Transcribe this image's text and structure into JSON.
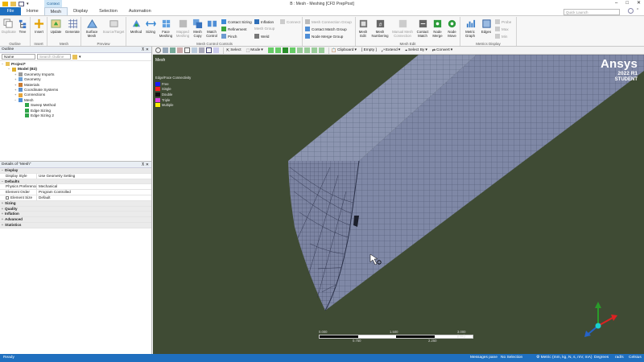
{
  "app": {
    "window_title": "B : Mesh - Meshing [CFD PrepPost]",
    "context_tab": "Context",
    "window_controls": [
      "–",
      "□",
      "✕"
    ]
  },
  "tabs": [
    {
      "label": "File",
      "active": false,
      "style": "file"
    },
    {
      "label": "Home",
      "active": false
    },
    {
      "label": "Mesh",
      "active": true
    },
    {
      "label": "Display",
      "active": false
    },
    {
      "label": "Selection",
      "active": false
    },
    {
      "label": "Automation",
      "active": false
    }
  ],
  "quick_search": {
    "placeholder": "Quick Launch"
  },
  "ribbon": {
    "outline_group": {
      "label": "Outline",
      "buttons": [
        "Duplicate",
        "Tree"
      ]
    },
    "insert_group": {
      "label": "Insert",
      "buttons": [
        "Insert"
      ]
    },
    "mesh_group": {
      "label": "Mesh",
      "buttons": [
        "Update",
        "Generate"
      ]
    },
    "preview_group": {
      "label": "Preview",
      "buttons": [
        "Surface Mesh",
        "Source/Target"
      ]
    },
    "controls_group": {
      "label": "Mesh Control Controls",
      "buttons": [
        "Method",
        "Sizing",
        "Face Meshing",
        "Mapped Meshing",
        "Mesh Copy",
        "Match Control"
      ],
      "small": [
        "Contact Sizing",
        "Refinement",
        "Pinch",
        "Inflation",
        "Mesh Group",
        "Weld",
        "Connect"
      ]
    },
    "connection_group": {
      "label": "",
      "items": [
        "Mesh Connection Group",
        "Contact Match Group",
        "Node Merge Group"
      ]
    },
    "edit_group": {
      "label": "Mesh Edit",
      "buttons": [
        "Mesh Edit",
        "Mesh Numbering",
        "Manual Mesh Connection",
        "Contact Match",
        "Node Merge",
        "Node Move"
      ]
    },
    "metrics_group": {
      "label": "Metrics Display",
      "buttons": [
        "Metric Graph",
        "Edges"
      ],
      "small": [
        "Probe",
        "Max",
        "Min"
      ]
    }
  },
  "outline": {
    "title": "Outline",
    "filter_label": "Name",
    "search_placeholder": "Search Outline",
    "tree": [
      {
        "label": "Project*",
        "level": 0,
        "bold": true,
        "expander": "−"
      },
      {
        "label": "Model (B3)",
        "level": 1,
        "bold": true,
        "expander": "−"
      },
      {
        "label": "Geometry Imports",
        "level": 2,
        "expander": "+"
      },
      {
        "label": "Geometry",
        "level": 2,
        "expander": "+"
      },
      {
        "label": "Materials",
        "level": 2,
        "expander": "+"
      },
      {
        "label": "Coordinate Systems",
        "level": 2,
        "expander": "+"
      },
      {
        "label": "Connections",
        "level": 2,
        "expander": "+"
      },
      {
        "label": "Mesh",
        "level": 2,
        "expander": "−"
      },
      {
        "label": "Sweep Method",
        "level": 3,
        "expander": ""
      },
      {
        "label": "Edge Sizing",
        "level": 3,
        "expander": ""
      },
      {
        "label": "Edge Sizing 2",
        "level": 3,
        "expander": ""
      }
    ]
  },
  "details": {
    "title": "Details of \"Mesh\"",
    "sections": [
      {
        "name": "Display",
        "expander": "−",
        "rows": [
          {
            "key": "Display Style",
            "value": "Use Geometry Setting"
          }
        ]
      },
      {
        "name": "Defaults",
        "expander": "−",
        "rows": [
          {
            "key": "Physics Preference",
            "value": "Mechanical"
          },
          {
            "key": "Element Order",
            "value": "Program Controlled"
          },
          {
            "key": "Element Size",
            "value": "Default",
            "checkbox": true
          }
        ]
      },
      {
        "name": "Sizing",
        "expander": "+",
        "rows": []
      },
      {
        "name": "Quality",
        "expander": "+",
        "rows": []
      },
      {
        "name": "Inflation",
        "expander": "+",
        "rows": []
      },
      {
        "name": "Advanced",
        "expander": "+",
        "rows": []
      },
      {
        "name": "Statistics",
        "expander": "+",
        "rows": []
      }
    ]
  },
  "graphics_toolbar": {
    "items": [
      "Select",
      "Mode",
      "Clipboard",
      "[ Empty ]",
      "Extend",
      "Select By",
      "Convert"
    ]
  },
  "viewport": {
    "label": "Mesh",
    "background": "#3f4b34",
    "legend_title": "Edge/Face Connectivity",
    "legend": [
      {
        "label": "Free",
        "color": "#1a1aff"
      },
      {
        "label": "Single",
        "color": "#ff2020"
      },
      {
        "label": "Double",
        "color": "#111111"
      },
      {
        "label": "Triple",
        "color": "#e040e0"
      },
      {
        "label": "Multiple",
        "color": "#ffee00"
      }
    ],
    "brand": "Ansys",
    "version": "2022 R1",
    "edition": "STUDENT",
    "scale": {
      "top_labels": [
        "0.000",
        "1.500",
        "3.000 (mm)"
      ],
      "bottom_labels": [
        "0.750",
        "2.250"
      ]
    }
  },
  "status": {
    "ready": "Ready",
    "messages": "Messages pane",
    "selection": "No Selection",
    "units": "Metric (mm, kg, N, s, mV, mA)",
    "angle": "Degrees",
    "rate": "rad/s",
    "temperature": "Celsius"
  }
}
